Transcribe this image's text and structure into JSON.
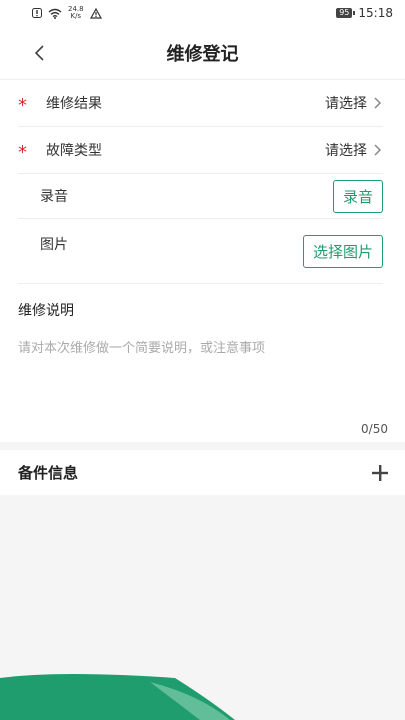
{
  "status_bar": {
    "net_speed_value": "24.8",
    "net_speed_unit": "K/s",
    "battery": "95",
    "time": "15:18"
  },
  "header": {
    "title": "维修登记"
  },
  "form": {
    "repair_result": {
      "label": "维修结果",
      "value": "请选择",
      "required": "*"
    },
    "fault_type": {
      "label": "故障类型",
      "value": "请选择",
      "required": "*"
    },
    "recording": {
      "label": "录音",
      "button": "录音"
    },
    "image": {
      "label": "图片",
      "button": "选择图片"
    }
  },
  "description": {
    "label": "维修说明",
    "placeholder": "请对本次维修做一个简要说明，或注意事项",
    "counter": "0/50"
  },
  "spare_parts": {
    "label": "备件信息"
  },
  "colors": {
    "accent": "#1f9d6e",
    "required": "#d32f2f"
  }
}
